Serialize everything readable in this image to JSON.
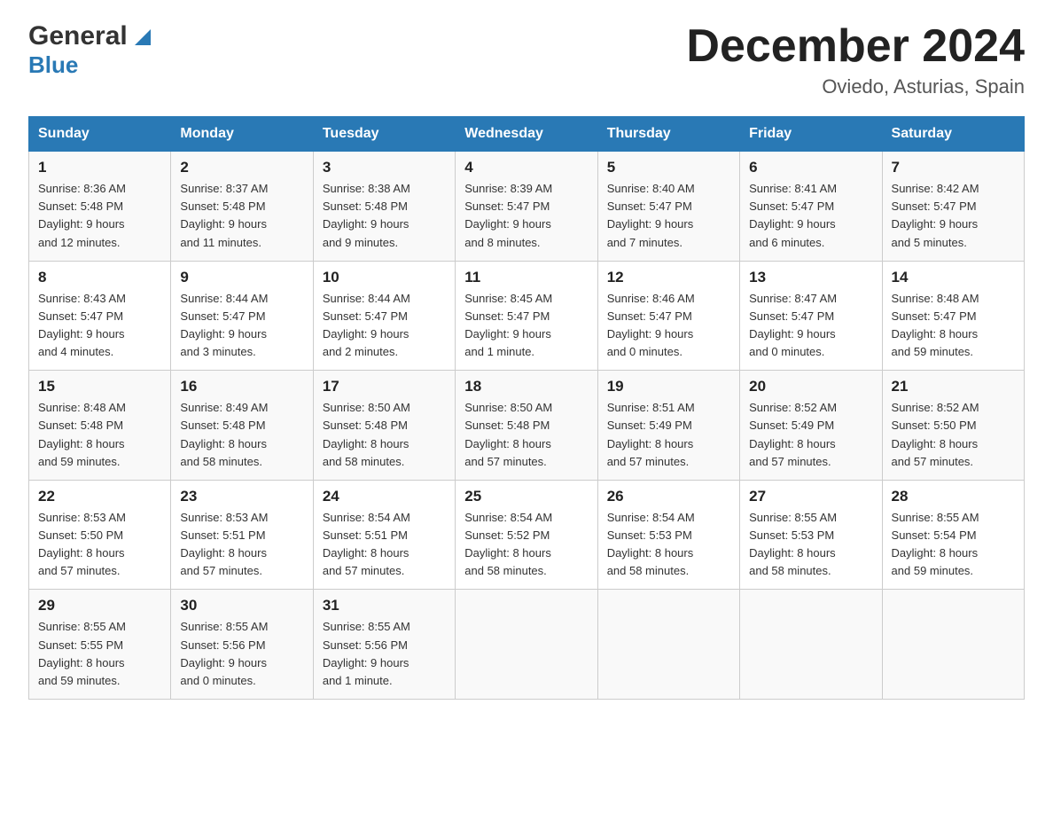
{
  "header": {
    "logo_general": "General",
    "logo_blue": "Blue",
    "month_title": "December 2024",
    "location": "Oviedo, Asturias, Spain"
  },
  "calendar": {
    "days_of_week": [
      "Sunday",
      "Monday",
      "Tuesday",
      "Wednesday",
      "Thursday",
      "Friday",
      "Saturday"
    ],
    "weeks": [
      [
        {
          "day": "1",
          "sunrise": "8:36 AM",
          "sunset": "5:48 PM",
          "daylight": "9 hours and 12 minutes."
        },
        {
          "day": "2",
          "sunrise": "8:37 AM",
          "sunset": "5:48 PM",
          "daylight": "9 hours and 11 minutes."
        },
        {
          "day": "3",
          "sunrise": "8:38 AM",
          "sunset": "5:48 PM",
          "daylight": "9 hours and 9 minutes."
        },
        {
          "day": "4",
          "sunrise": "8:39 AM",
          "sunset": "5:47 PM",
          "daylight": "9 hours and 8 minutes."
        },
        {
          "day": "5",
          "sunrise": "8:40 AM",
          "sunset": "5:47 PM",
          "daylight": "9 hours and 7 minutes."
        },
        {
          "day": "6",
          "sunrise": "8:41 AM",
          "sunset": "5:47 PM",
          "daylight": "9 hours and 6 minutes."
        },
        {
          "day": "7",
          "sunrise": "8:42 AM",
          "sunset": "5:47 PM",
          "daylight": "9 hours and 5 minutes."
        }
      ],
      [
        {
          "day": "8",
          "sunrise": "8:43 AM",
          "sunset": "5:47 PM",
          "daylight": "9 hours and 4 minutes."
        },
        {
          "day": "9",
          "sunrise": "8:44 AM",
          "sunset": "5:47 PM",
          "daylight": "9 hours and 3 minutes."
        },
        {
          "day": "10",
          "sunrise": "8:44 AM",
          "sunset": "5:47 PM",
          "daylight": "9 hours and 2 minutes."
        },
        {
          "day": "11",
          "sunrise": "8:45 AM",
          "sunset": "5:47 PM",
          "daylight": "9 hours and 1 minute."
        },
        {
          "day": "12",
          "sunrise": "8:46 AM",
          "sunset": "5:47 PM",
          "daylight": "9 hours and 0 minutes."
        },
        {
          "day": "13",
          "sunrise": "8:47 AM",
          "sunset": "5:47 PM",
          "daylight": "9 hours and 0 minutes."
        },
        {
          "day": "14",
          "sunrise": "8:48 AM",
          "sunset": "5:47 PM",
          "daylight": "8 hours and 59 minutes."
        }
      ],
      [
        {
          "day": "15",
          "sunrise": "8:48 AM",
          "sunset": "5:48 PM",
          "daylight": "8 hours and 59 minutes."
        },
        {
          "day": "16",
          "sunrise": "8:49 AM",
          "sunset": "5:48 PM",
          "daylight": "8 hours and 58 minutes."
        },
        {
          "day": "17",
          "sunrise": "8:50 AM",
          "sunset": "5:48 PM",
          "daylight": "8 hours and 58 minutes."
        },
        {
          "day": "18",
          "sunrise": "8:50 AM",
          "sunset": "5:48 PM",
          "daylight": "8 hours and 57 minutes."
        },
        {
          "day": "19",
          "sunrise": "8:51 AM",
          "sunset": "5:49 PM",
          "daylight": "8 hours and 57 minutes."
        },
        {
          "day": "20",
          "sunrise": "8:52 AM",
          "sunset": "5:49 PM",
          "daylight": "8 hours and 57 minutes."
        },
        {
          "day": "21",
          "sunrise": "8:52 AM",
          "sunset": "5:50 PM",
          "daylight": "8 hours and 57 minutes."
        }
      ],
      [
        {
          "day": "22",
          "sunrise": "8:53 AM",
          "sunset": "5:50 PM",
          "daylight": "8 hours and 57 minutes."
        },
        {
          "day": "23",
          "sunrise": "8:53 AM",
          "sunset": "5:51 PM",
          "daylight": "8 hours and 57 minutes."
        },
        {
          "day": "24",
          "sunrise": "8:54 AM",
          "sunset": "5:51 PM",
          "daylight": "8 hours and 57 minutes."
        },
        {
          "day": "25",
          "sunrise": "8:54 AM",
          "sunset": "5:52 PM",
          "daylight": "8 hours and 58 minutes."
        },
        {
          "day": "26",
          "sunrise": "8:54 AM",
          "sunset": "5:53 PM",
          "daylight": "8 hours and 58 minutes."
        },
        {
          "day": "27",
          "sunrise": "8:55 AM",
          "sunset": "5:53 PM",
          "daylight": "8 hours and 58 minutes."
        },
        {
          "day": "28",
          "sunrise": "8:55 AM",
          "sunset": "5:54 PM",
          "daylight": "8 hours and 59 minutes."
        }
      ],
      [
        {
          "day": "29",
          "sunrise": "8:55 AM",
          "sunset": "5:55 PM",
          "daylight": "8 hours and 59 minutes."
        },
        {
          "day": "30",
          "sunrise": "8:55 AM",
          "sunset": "5:56 PM",
          "daylight": "9 hours and 0 minutes."
        },
        {
          "day": "31",
          "sunrise": "8:55 AM",
          "sunset": "5:56 PM",
          "daylight": "9 hours and 1 minute."
        },
        {
          "day": "",
          "sunrise": "",
          "sunset": "",
          "daylight": ""
        },
        {
          "day": "",
          "sunrise": "",
          "sunset": "",
          "daylight": ""
        },
        {
          "day": "",
          "sunrise": "",
          "sunset": "",
          "daylight": ""
        },
        {
          "day": "",
          "sunrise": "",
          "sunset": "",
          "daylight": ""
        }
      ]
    ],
    "labels": {
      "sunrise": "Sunrise:",
      "sunset": "Sunset:",
      "daylight": "Daylight:"
    }
  }
}
